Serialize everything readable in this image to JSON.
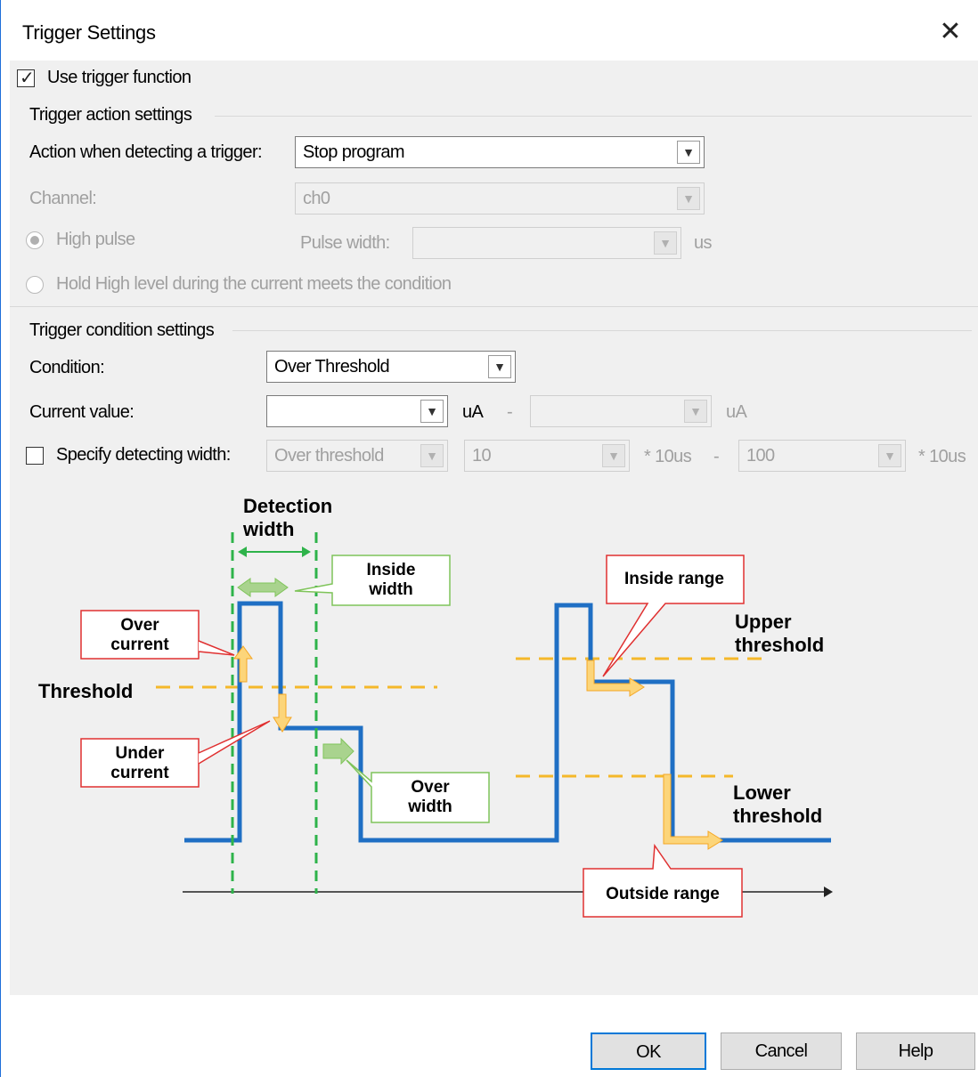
{
  "window": {
    "title": "Trigger Settings",
    "close_glyph": "✕"
  },
  "use_trigger": {
    "label": "Use trigger function",
    "checked": true
  },
  "trigger_action": {
    "group_label": "Trigger action settings",
    "action_label": "Action when detecting a trigger:",
    "action_value": "Stop program",
    "channel_label": "Channel:",
    "channel_value": "ch0",
    "high_pulse_label": "High pulse",
    "pulse_width_label": "Pulse width:",
    "pulse_width_value": "",
    "pulse_width_unit": "us",
    "hold_high_label": "Hold High level during the current meets the condition"
  },
  "trigger_condition": {
    "group_label": "Trigger condition settings",
    "condition_label": "Condition:",
    "condition_value": "Over Threshold",
    "current_label": "Current value:",
    "current_value": "",
    "current_unit": "uA",
    "range_dash": "-",
    "current_value2": "",
    "current_unit2": "uA",
    "specify_width_label": "Specify detecting width:",
    "specify_width_checked": false,
    "width_mode_value": "Over threshold",
    "width_min_value": "10",
    "width_unit1": "* 10us",
    "width_dash": "-",
    "width_max_value": "100",
    "width_unit2": "* 10us"
  },
  "diagram": {
    "detection_width_line1": "Detection",
    "detection_width_line2": "width",
    "inside_width_line1": "Inside",
    "inside_width_line2": "width",
    "over_current_line1": "Over",
    "over_current_line2": "current",
    "threshold": "Threshold",
    "under_current_line1": "Under",
    "under_current_line2": "current",
    "over_width_line1": "Over",
    "over_width_line2": "width",
    "inside_range": "Inside range",
    "upper_threshold_line1": "Upper",
    "upper_threshold_line2": "threshold",
    "lower_threshold_line1": "Lower",
    "lower_threshold_line2": "threshold",
    "outside_range": "Outside range",
    "colors": {
      "signal": "#1f6fc4",
      "threshold": "#f5b82a",
      "detection": "#2eb34a",
      "callout_red": "#e03030",
      "callout_green": "#7fc45a"
    }
  },
  "buttons": {
    "ok": "OK",
    "cancel": "Cancel",
    "help": "Help"
  }
}
